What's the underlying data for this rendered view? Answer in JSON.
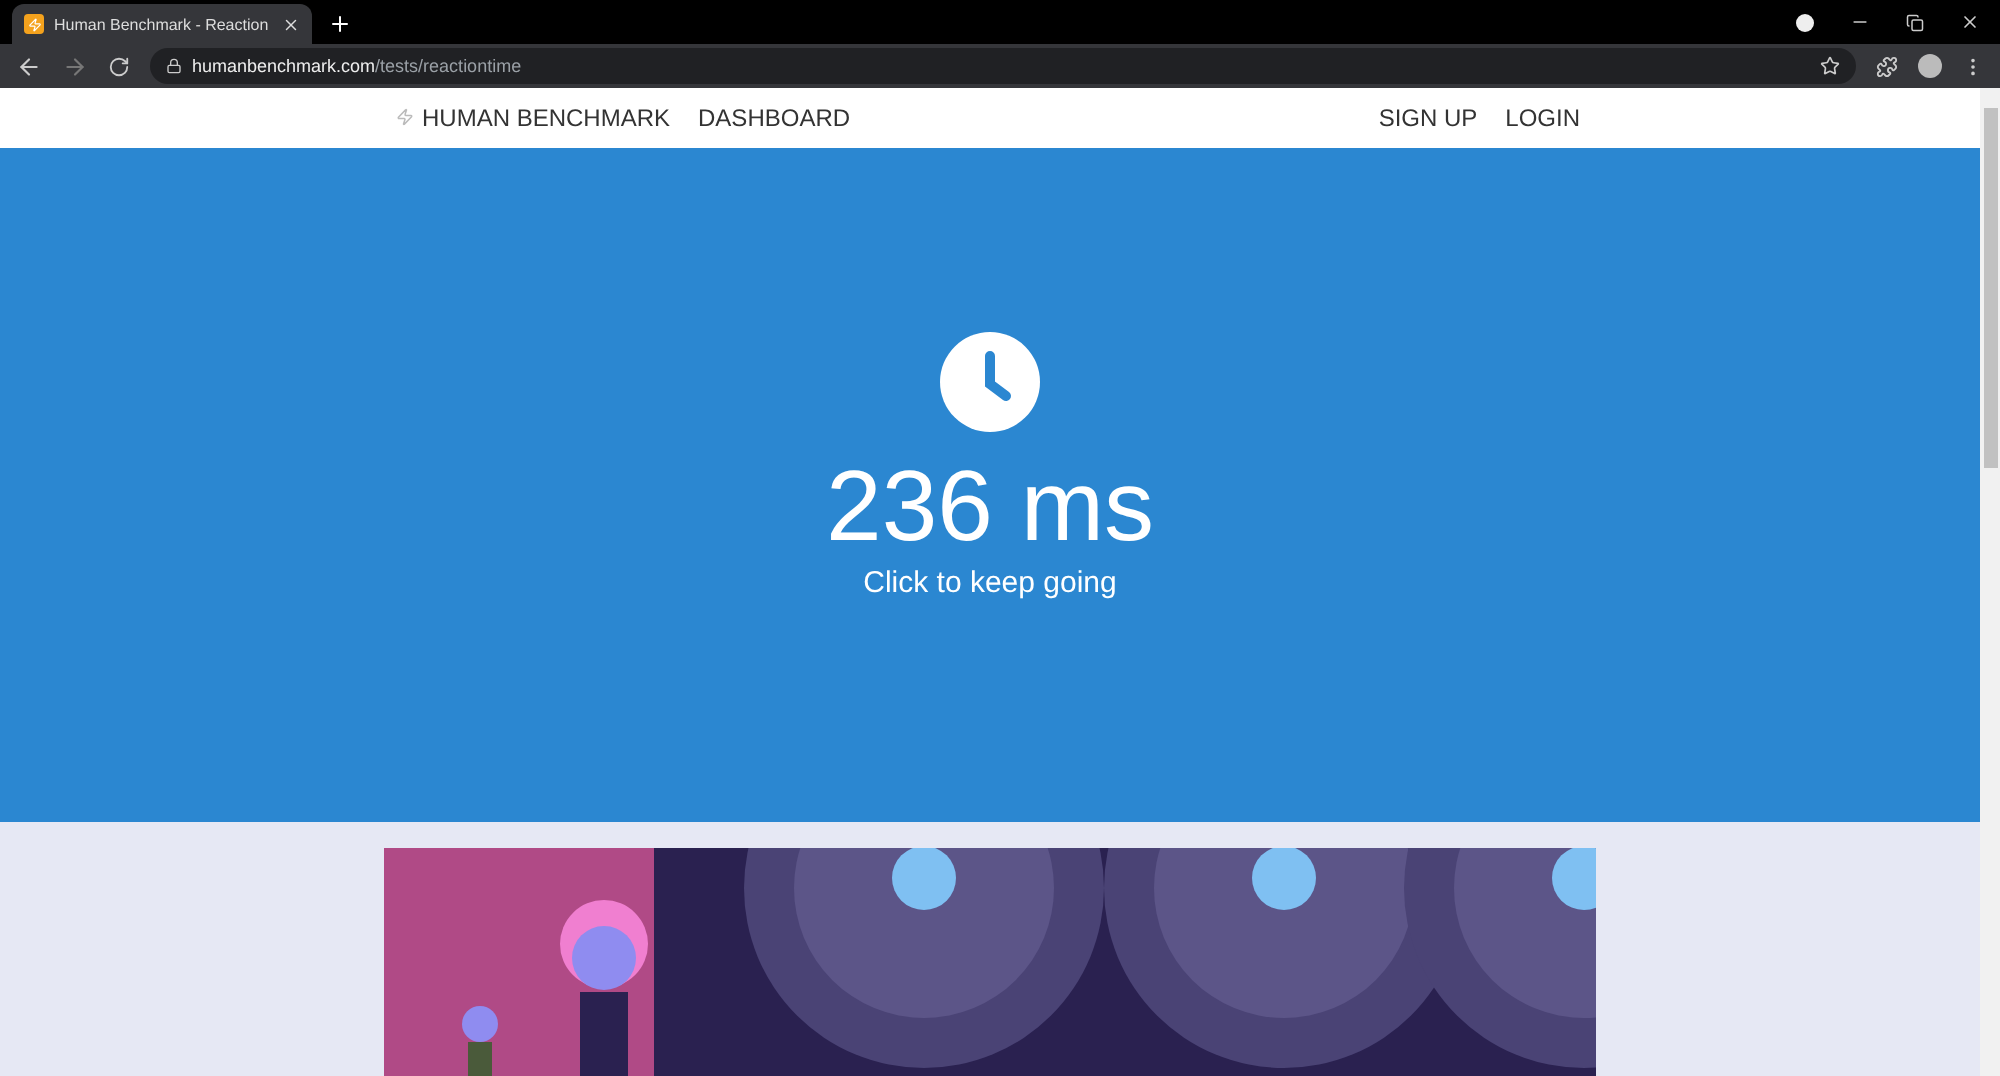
{
  "browser": {
    "tab_title": "Human Benchmark - Reaction",
    "url_host": "humanbenchmark.com",
    "url_path": "/tests/reactiontime"
  },
  "nav": {
    "brand": "HUMAN BENCHMARK",
    "links": [
      "DASHBOARD"
    ],
    "right_links": [
      "SIGN UP",
      "LOGIN"
    ]
  },
  "result": {
    "time": "236 ms",
    "prompt": "Click to keep going"
  }
}
